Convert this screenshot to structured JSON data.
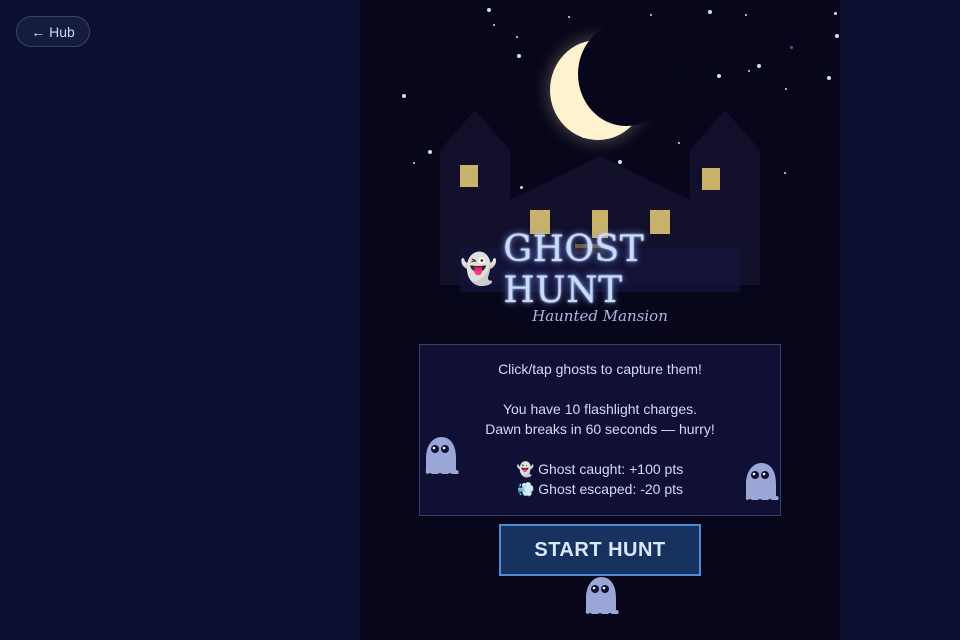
{
  "nav": {
    "hub_label": "← Hub"
  },
  "game": {
    "title_icon": "👻",
    "title": "GHOST HUNT",
    "subtitle": "Haunted Mansion",
    "instructions": {
      "line1": "Click/tap ghosts to capture them!",
      "line2": "You have 10 flashlight charges.",
      "line3": "Dawn breaks in 60 seconds — hurry!",
      "caught_icon": "👻",
      "caught_text": "Ghost caught: +100 pts",
      "escaped_icon": "💨",
      "escaped_text": "Ghost escaped: -20 pts"
    },
    "start_label": "START HUNT"
  },
  "colors": {
    "page_bg": "#0b1030",
    "stage_bg": "#07061a",
    "moon": "#fff3cf",
    "window": "#c9b26a",
    "ghost": "#9aa6d6",
    "button_border": "#4f8cd8"
  },
  "icons": [
    "ghost-icon",
    "wind-icon",
    "moon-icon",
    "arrow-left-icon"
  ]
}
